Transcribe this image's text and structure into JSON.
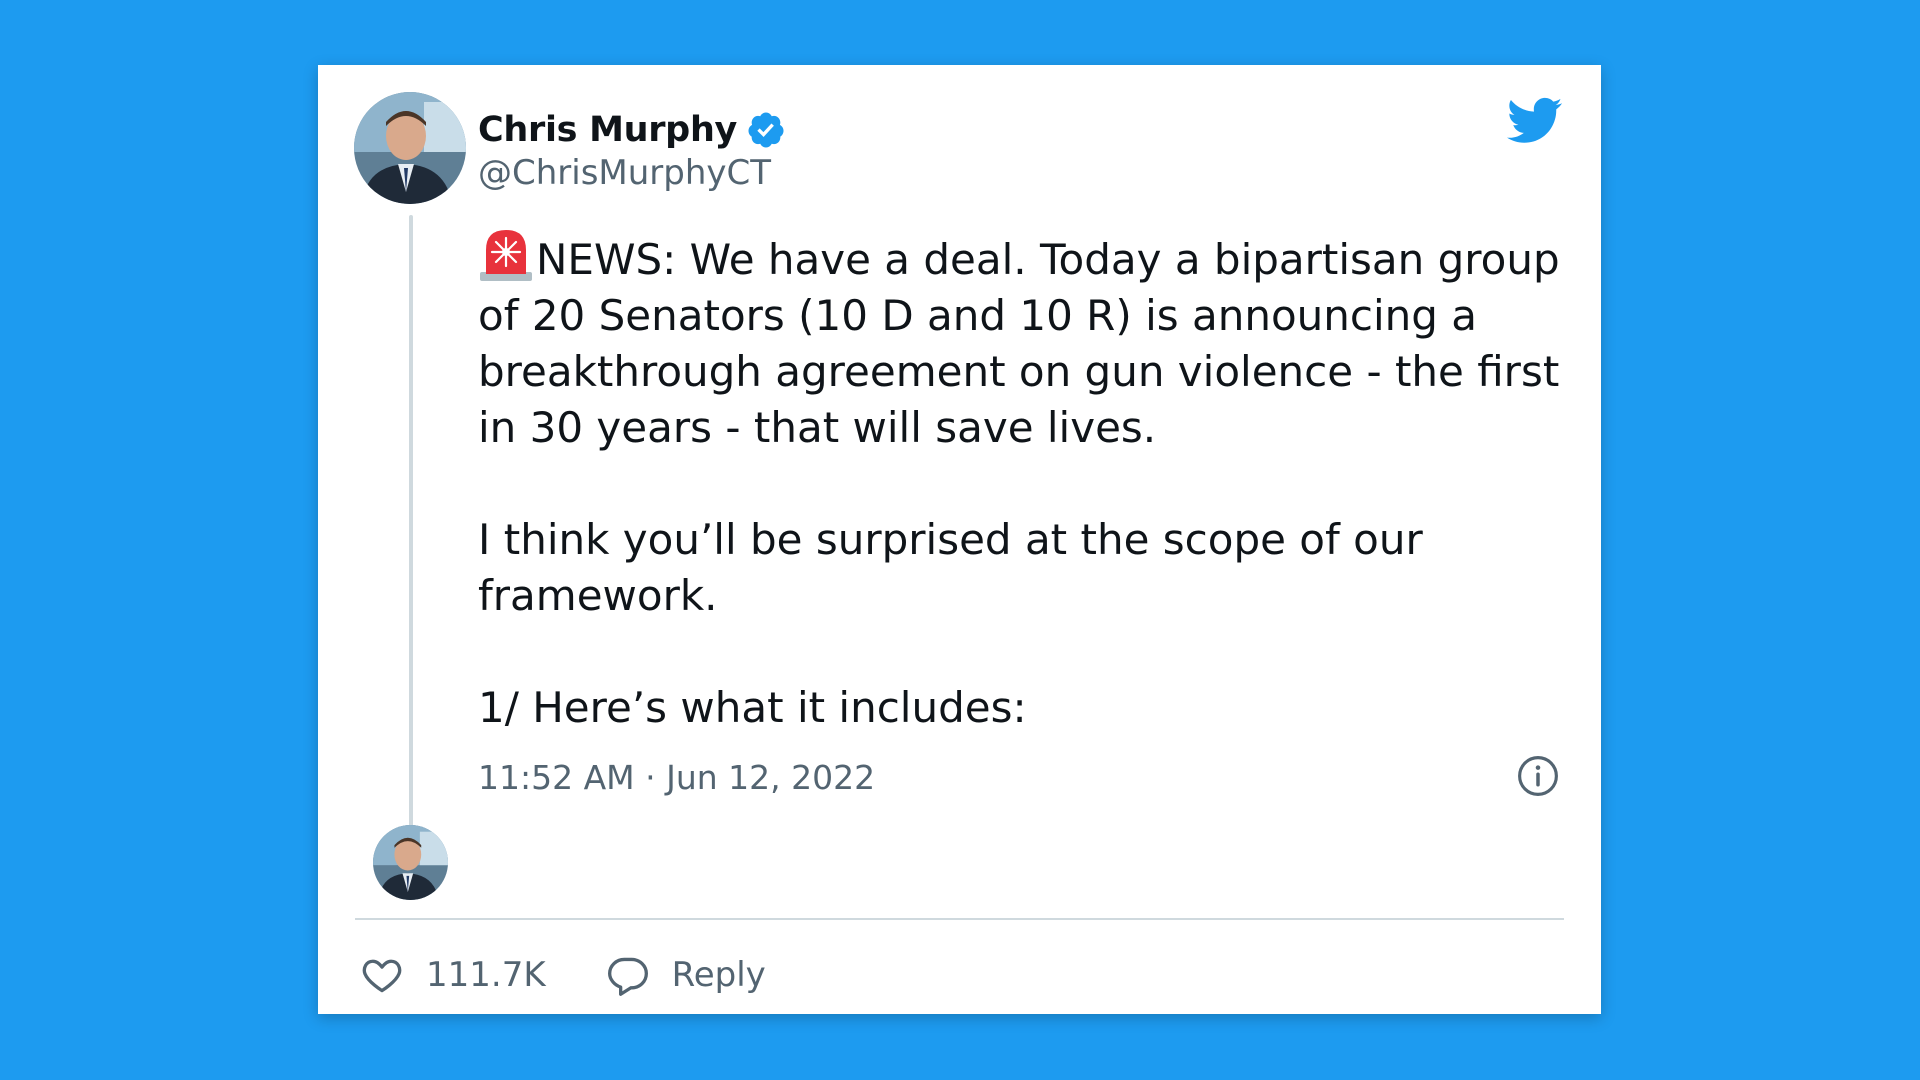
{
  "tweet": {
    "author": {
      "display_name": "Chris Murphy",
      "handle": "@ChrisMurphyCT",
      "verified": true,
      "avatar_icon": "user-avatar"
    },
    "siren_emoji": "🚨",
    "paragraphs": [
      "NEWS: We have a deal. Today a bipartisan group of 20 Senators (10 D and 10 R) is announcing a breakthrough agreement on gun violence - the first in 30 years - that will save lives.",
      "I think you’ll be surprised at the scope of our framework.",
      "1/ Here’s what it includes:"
    ],
    "timestamp": "11:52 AM · Jun 12, 2022",
    "likes_count": "111.7K",
    "reply_label": "Reply"
  },
  "colors": {
    "background": "#1d9bf0",
    "accent": "#1d9bf0",
    "text_primary": "#0f1419",
    "text_secondary": "#536471",
    "divider": "#cfd9de"
  },
  "icons": [
    "twitter-bird-icon",
    "verified-badge-icon",
    "siren-icon",
    "info-icon",
    "heart-icon",
    "reply-icon"
  ]
}
